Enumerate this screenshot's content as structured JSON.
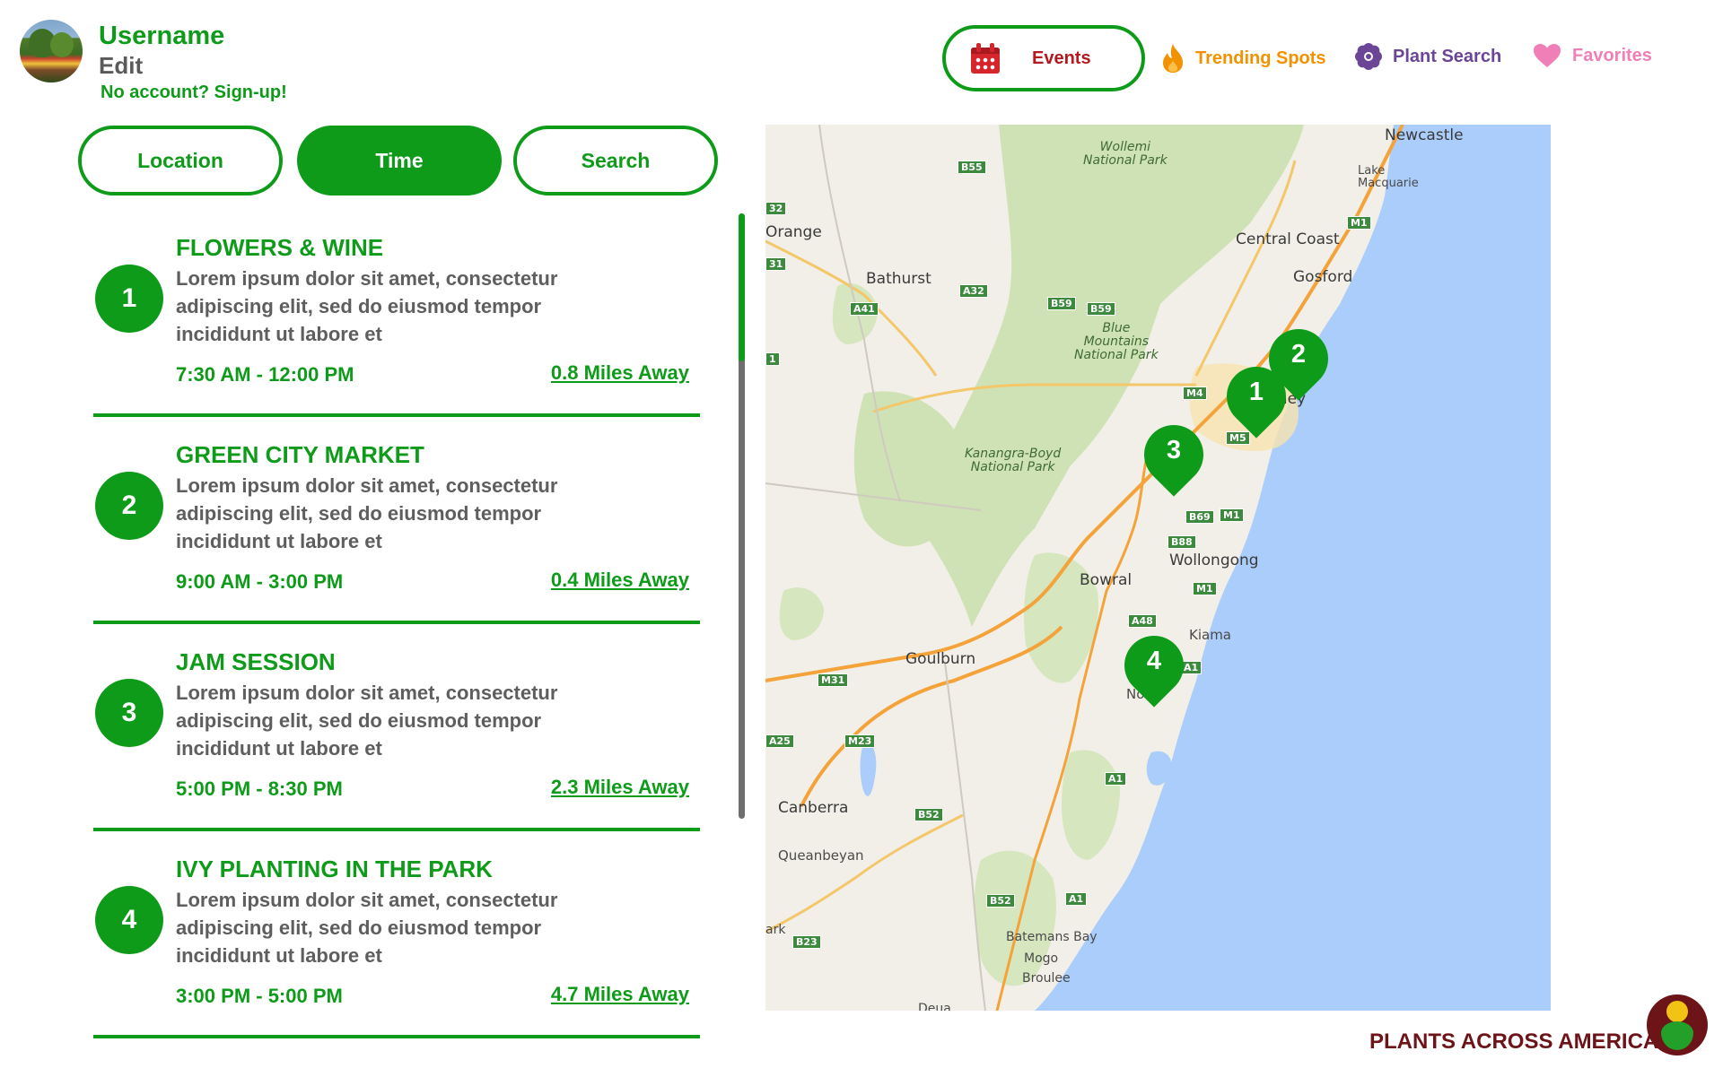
{
  "profile": {
    "username": "Username",
    "edit_label": "Edit",
    "signup_label": "No account? Sign-up!"
  },
  "nav": {
    "events": "Events",
    "trending": "Trending Spots",
    "plant_search": "Plant Search",
    "favorites": "Favorites"
  },
  "filters": {
    "location": "Location",
    "time": "Time",
    "search": "Search",
    "active": "Time"
  },
  "events": [
    {
      "number": "1",
      "title": "FLOWERS & WINE",
      "description": "Lorem ipsum dolor sit amet, consectetur adipiscing elit, sed do eiusmod tempor incididunt ut labore et",
      "time": "7:30 AM - 12:00 PM",
      "distance": "0.8 Miles Away"
    },
    {
      "number": "2",
      "title": "GREEN CITY MARKET",
      "description": "Lorem ipsum dolor sit amet, consectetur adipiscing elit, sed do eiusmod tempor incididunt ut labore et",
      "time": "9:00 AM - 3:00 PM",
      "distance": "0.4 Miles Away"
    },
    {
      "number": "3",
      "title": "JAM SESSION",
      "description": "Lorem ipsum dolor sit amet, consectetur adipiscing elit, sed do eiusmod tempor incididunt ut labore et",
      "time": "5:00 PM - 8:30 PM",
      "distance": "2.3 Miles Away"
    },
    {
      "number": "4",
      "title": "IVY PLANTING IN THE PARK",
      "description": "Lorem ipsum dolor sit amet, consectetur adipiscing elit, sed do eiusmod tempor incididunt ut labore et",
      "time": "3:00 PM - 5:00 PM",
      "distance": "4.7 Miles Away"
    }
  ],
  "map": {
    "places": {
      "newcastle": "Newcastle",
      "lake_macquarie": "Lake\nMacquarie",
      "central_coast": "Central Coast",
      "gosford": "Gosford",
      "orange": "Orange",
      "bathurst": "Bathurst",
      "sydney": "dney",
      "wollongong": "Wollongong",
      "bowral": "Bowral",
      "kiama": "Kiama",
      "goulburn": "Goulburn",
      "nowra": "No",
      "canberra": "Canberra",
      "queanbeyan": "Queanbeyan",
      "batemans_bay": "Batemans Bay",
      "mogo": "Mogo",
      "broulee": "Broulee",
      "moruya": "Deua",
      "ark": "ark"
    },
    "parks": {
      "wollemi": "Wollemi\nNational Park",
      "blue_mountains": "Blue\nMountains\nNational Park",
      "kanangra": "Kanangra-Boyd\nNational Park"
    },
    "roads": [
      "B55",
      "A32",
      "A41",
      "B59",
      "B59",
      "M4",
      "M5",
      "M1",
      "M1",
      "B69",
      "B88",
      "M1",
      "A48",
      "A1",
      "M31",
      "M23",
      "A25",
      "A1",
      "B52",
      "B52",
      "A1",
      "B23",
      "M1",
      "32",
      "1",
      "31"
    ],
    "pins": [
      "1",
      "2",
      "3",
      "4"
    ]
  },
  "brand": {
    "name": "PLANTS ACROSS AMERICA"
  },
  "colors": {
    "primary_green": "#0f9b1a",
    "events_red": "#b3191e",
    "trending_orange": "#f39200",
    "plant_purple": "#6b4596",
    "favorites_pink": "#f07fb8",
    "brand_maroon": "#6d1418",
    "ocean": "#abcdfb"
  }
}
